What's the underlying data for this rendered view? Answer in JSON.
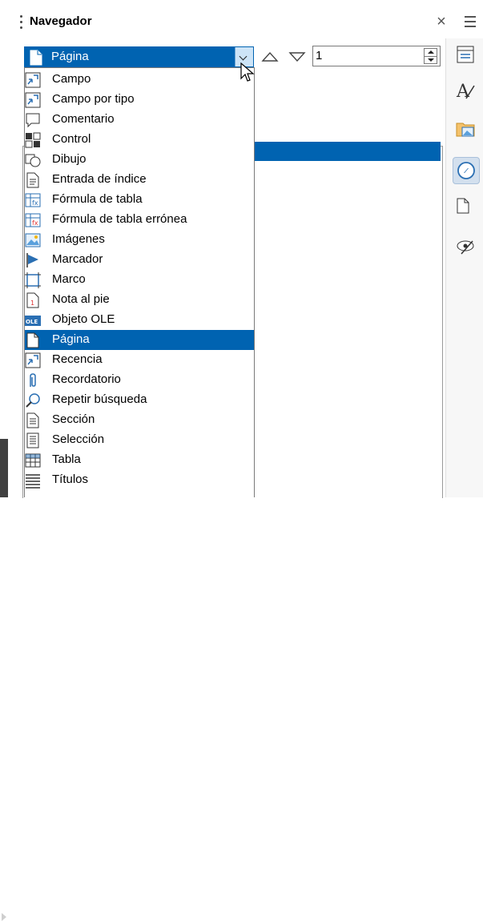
{
  "panel": {
    "title": "Navegador",
    "close_glyph": "×"
  },
  "combo": {
    "selected": "Página",
    "icon": "page-icon"
  },
  "spin": {
    "value": "1"
  },
  "dropdown": {
    "items": [
      {
        "label": "Campo",
        "icon": "field-icon"
      },
      {
        "label": "Campo por tipo",
        "icon": "field-by-type-icon"
      },
      {
        "label": "Comentario",
        "icon": "comment-icon"
      },
      {
        "label": "Control",
        "icon": "control-icon"
      },
      {
        "label": "Dibujo",
        "icon": "drawing-icon"
      },
      {
        "label": "Entrada de índice",
        "icon": "index-entry-icon"
      },
      {
        "label": "Fórmula de tabla",
        "icon": "table-formula-icon"
      },
      {
        "label": "Fórmula de tabla errónea",
        "icon": "wrong-table-formula-icon"
      },
      {
        "label": "Imágenes",
        "icon": "images-icon"
      },
      {
        "label": "Marcador",
        "icon": "bookmark-icon"
      },
      {
        "label": "Marco",
        "icon": "frame-icon"
      },
      {
        "label": "Nota al pie",
        "icon": "footnote-icon"
      },
      {
        "label": "Objeto OLE",
        "icon": "ole-object-icon"
      },
      {
        "label": "Página",
        "icon": "page-icon",
        "selected": true
      },
      {
        "label": "Recencia",
        "icon": "recency-icon"
      },
      {
        "label": "Recordatorio",
        "icon": "reminder-icon"
      },
      {
        "label": "Repetir búsqueda",
        "icon": "repeat-search-icon"
      },
      {
        "label": "Sección",
        "icon": "section-icon"
      },
      {
        "label": "Selección",
        "icon": "selection-icon"
      },
      {
        "label": "Tabla",
        "icon": "table-icon"
      },
      {
        "label": "Títulos",
        "icon": "headings-icon"
      }
    ]
  },
  "sidebar_tabs": [
    {
      "name": "properties-icon"
    },
    {
      "name": "styles-icon"
    },
    {
      "name": "gallery-icon"
    },
    {
      "name": "navigator-icon",
      "active": true
    },
    {
      "name": "page-icon"
    },
    {
      "name": "style-inspector-icon"
    }
  ],
  "colors": {
    "selection": "#0063b1",
    "text": "#000000"
  }
}
